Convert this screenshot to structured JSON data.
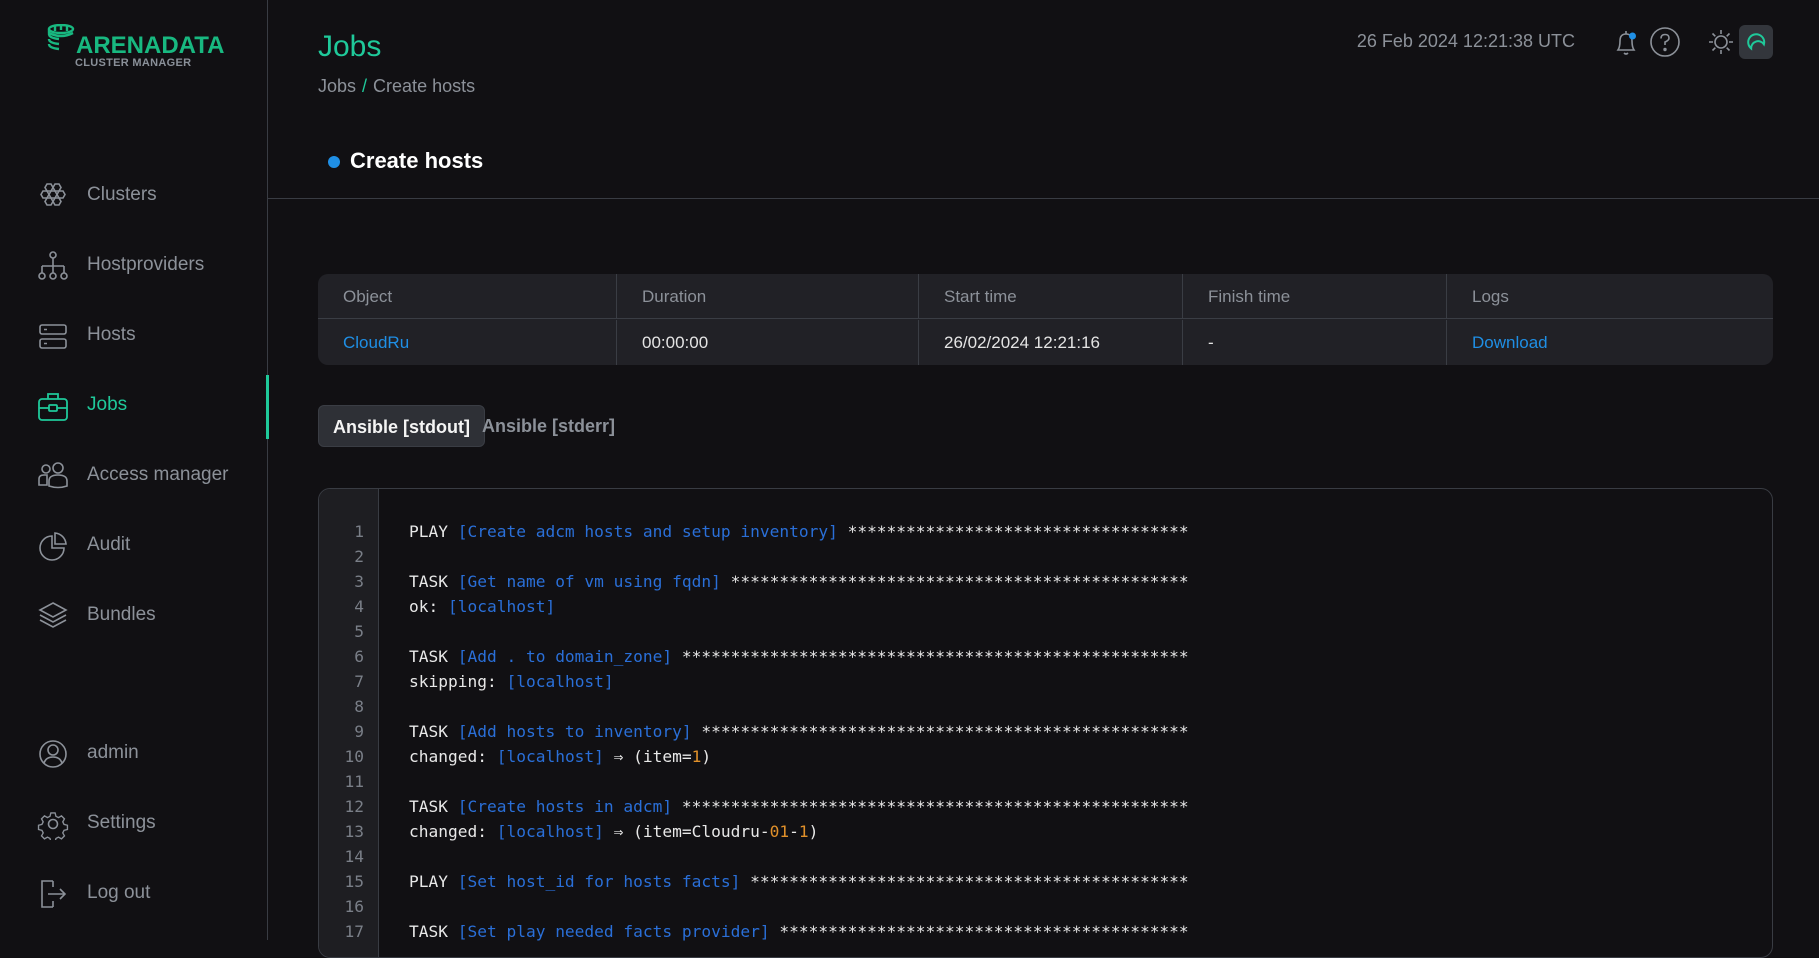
{
  "app": {
    "logo": {
      "name": "ARENADATA",
      "subtitle": "CLUSTER MANAGER",
      "brand_color": "#18b880"
    }
  },
  "sidebar": {
    "items": [
      {
        "label": "Clusters",
        "icon": "clusters-icon",
        "active": false
      },
      {
        "label": "Hostproviders",
        "icon": "hostproviders-icon",
        "active": false
      },
      {
        "label": "Hosts",
        "icon": "hosts-icon",
        "active": false
      },
      {
        "label": "Jobs",
        "icon": "briefcase-icon",
        "active": true
      },
      {
        "label": "Access manager",
        "icon": "users-icon",
        "active": false
      },
      {
        "label": "Audit",
        "icon": "pie-chart-icon",
        "active": false
      },
      {
        "label": "Bundles",
        "icon": "layers-icon",
        "active": false
      }
    ],
    "bottom_items": [
      {
        "label": "admin",
        "icon": "user-circle-icon"
      },
      {
        "label": "Settings",
        "icon": "gear-icon"
      },
      {
        "label": "Log out",
        "icon": "logout-icon"
      }
    ],
    "accent_color": "#1fc99a"
  },
  "header": {
    "title": "Jobs",
    "breadcrumb": [
      "Jobs",
      "Create hosts"
    ],
    "breadcrumb_sep": "/",
    "datetime": "26 Feb 2024  12:21:38  UTC",
    "icons": [
      "bell-icon",
      "help-icon",
      "sun-icon",
      "moon-icon"
    ],
    "notification_dot_color": "#1f8fe5"
  },
  "job": {
    "title": "Create hosts",
    "status_color": "#1f8fe5",
    "table": {
      "columns": [
        "Object",
        "Duration",
        "Start time",
        "Finish time",
        "Logs"
      ],
      "row": {
        "object": "CloudRu",
        "duration": "00:00:00",
        "start_time": "26/02/2024 12:21:16",
        "finish_time": "-",
        "logs": "Download"
      }
    }
  },
  "tabs": [
    {
      "label": "Ansible [stdout]",
      "active": true
    },
    {
      "label": "Ansible [stderr]",
      "active": false
    }
  ],
  "log": {
    "lines": [
      {
        "n": "1",
        "parts": [
          [
            "w",
            "PLAY "
          ],
          [
            "b",
            "[Create adcm hosts and setup inventory]"
          ],
          [
            "w",
            " ***********************************"
          ]
        ]
      },
      {
        "n": "2",
        "parts": []
      },
      {
        "n": "3",
        "parts": [
          [
            "w",
            "TASK "
          ],
          [
            "b",
            "[Get name of vm using fqdn]"
          ],
          [
            "w",
            " ***********************************************"
          ]
        ]
      },
      {
        "n": "4",
        "parts": [
          [
            "w",
            "ok: "
          ],
          [
            "b",
            "[localhost]"
          ]
        ]
      },
      {
        "n": "5",
        "parts": []
      },
      {
        "n": "6",
        "parts": [
          [
            "w",
            "TASK "
          ],
          [
            "b",
            "[Add . to domain_zone]"
          ],
          [
            "w",
            " ****************************************************"
          ]
        ]
      },
      {
        "n": "7",
        "parts": [
          [
            "w",
            "skipping: "
          ],
          [
            "b",
            "[localhost]"
          ]
        ]
      },
      {
        "n": "8",
        "parts": []
      },
      {
        "n": "9",
        "parts": [
          [
            "w",
            "TASK "
          ],
          [
            "b",
            "[Add hosts to inventory]"
          ],
          [
            "w",
            " **************************************************"
          ]
        ]
      },
      {
        "n": "10",
        "parts": [
          [
            "w",
            "changed: "
          ],
          [
            "b",
            "[localhost]"
          ],
          [
            "w",
            " ⇒ (item="
          ],
          [
            "o",
            "1"
          ],
          [
            "w",
            ")"
          ]
        ]
      },
      {
        "n": "11",
        "parts": []
      },
      {
        "n": "12",
        "parts": [
          [
            "w",
            "TASK "
          ],
          [
            "b",
            "[Create hosts in adcm]"
          ],
          [
            "w",
            " ****************************************************"
          ]
        ]
      },
      {
        "n": "13",
        "parts": [
          [
            "w",
            "changed: "
          ],
          [
            "b",
            "[localhost]"
          ],
          [
            "w",
            " ⇒ (item=Cloudru-"
          ],
          [
            "o",
            "01"
          ],
          [
            "w",
            "-"
          ],
          [
            "o",
            "1"
          ],
          [
            "w",
            ")"
          ]
        ]
      },
      {
        "n": "14",
        "parts": []
      },
      {
        "n": "15",
        "parts": [
          [
            "w",
            "PLAY "
          ],
          [
            "b",
            "[Set host_id for hosts facts]"
          ],
          [
            "w",
            " *********************************************"
          ]
        ]
      },
      {
        "n": "16",
        "parts": []
      },
      {
        "n": "17",
        "parts": [
          [
            "w",
            "TASK "
          ],
          [
            "b",
            "[Set play needed facts provider]"
          ],
          [
            "w",
            " ******************************************"
          ]
        ]
      }
    ]
  }
}
